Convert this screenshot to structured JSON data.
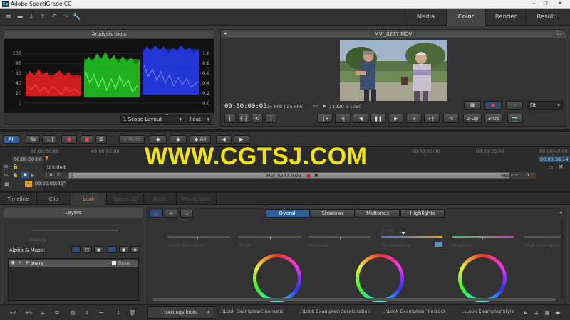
{
  "window": {
    "title": "Adobe SpeedGrade CC",
    "app_icon": "Sg",
    "controls": [
      "minimize-icon",
      "maximize-icon",
      "close-icon"
    ]
  },
  "toolbar": {
    "icons": [
      "menu-icon",
      "save-icon",
      "import-icon",
      "export-icon",
      "undo-icon",
      "redo-icon",
      "wrench-icon"
    ]
  },
  "workspace_tabs": {
    "items": [
      {
        "label": "Media",
        "active": false
      },
      {
        "label": "Color",
        "active": true
      },
      {
        "label": "Render",
        "active": false
      },
      {
        "label": "Result",
        "active": false
      }
    ]
  },
  "analysis": {
    "title": "Analysis tools",
    "y_left": [
      "100",
      "80",
      "60",
      "40",
      "20",
      "0"
    ],
    "y_right": [
      "1.0",
      "0.8",
      "0.6",
      "0.4",
      "0.2",
      "0.0"
    ],
    "layout_select": "1 Scope Layout",
    "format_select": "float",
    "colors": {
      "red": "#d01818",
      "green": "#22c022",
      "blue": "#2030e0"
    }
  },
  "viewer": {
    "title": "MVI_0277.MOV",
    "timecode": "00:00:00:05",
    "fps1": "25 FPS",
    "fps2": "25 FPS",
    "resolution": "1920 x 1080",
    "fit_select": "Fit",
    "btn_2up": "2-Up",
    "btn_3up": "3-Up"
  },
  "timeline_toolbar": {
    "all": "All",
    "six": "6s",
    "dots": "|...|",
    "auto": "+ Auto",
    "all2": "All"
  },
  "ruler": {
    "ticks": [
      "00:00:00:00",
      "00:00:05:00",
      "00:00:30:00",
      "00:00:35:00",
      "00:00:40:00"
    ],
    "start_tc": "00:00:00:00",
    "end_tc": "00:00:38:14",
    "untitled": "Untitled"
  },
  "track": {
    "left_num": "0",
    "clip_start": "0",
    "clip_name": "MVI_0277.MOV",
    "clip_end": "963",
    "right_num": "0",
    "sub_num": "1",
    "sub_tc": "00:00:00:05"
  },
  "watermark": "WWW.CGTSJ.COM",
  "bottom_tabs": {
    "items": [
      {
        "label": "Timeline",
        "active": false,
        "dim": false
      },
      {
        "label": "Clip",
        "active": false,
        "dim": false
      },
      {
        "label": "Look",
        "active": true,
        "dim": false
      },
      {
        "label": "Stereo 3D",
        "active": false,
        "dim": true
      },
      {
        "label": "Audio",
        "active": false,
        "dim": true
      },
      {
        "label": "Pan & Scan",
        "active": false,
        "dim": true
      }
    ]
  },
  "layers": {
    "title": "Layers",
    "opacity_label": "Opacity",
    "alpha_mask": "Alpha & Mask:",
    "primary": "Primary",
    "reset": "Reset"
  },
  "grading": {
    "tabs": [
      {
        "label": "Overall",
        "active": true
      },
      {
        "label": "Shadows",
        "active": false
      },
      {
        "label": "Midtones",
        "active": false
      },
      {
        "label": "Highlights",
        "active": false
      }
    ],
    "sliders": [
      "Input Saturation",
      "Pivot",
      "Contrast",
      "Temperature",
      "Magenta",
      "Final Saturation"
    ],
    "temperature_value": "0.000"
  },
  "looks_bar": {
    "tabs": [
      "..\\settings\\looks",
      "..\\Look Examples\\Cinematic",
      "..\\Look Examples\\Desaturation",
      "..\\Look Examples\\Filmstock",
      "..\\Look Examples\\Style"
    ]
  },
  "layer_buttons": [
    "+P",
    "+S",
    "+",
    "copy-icon",
    "paste-icon",
    "merge-icon",
    "stack-icon",
    "import-look-icon",
    "trash-icon"
  ]
}
